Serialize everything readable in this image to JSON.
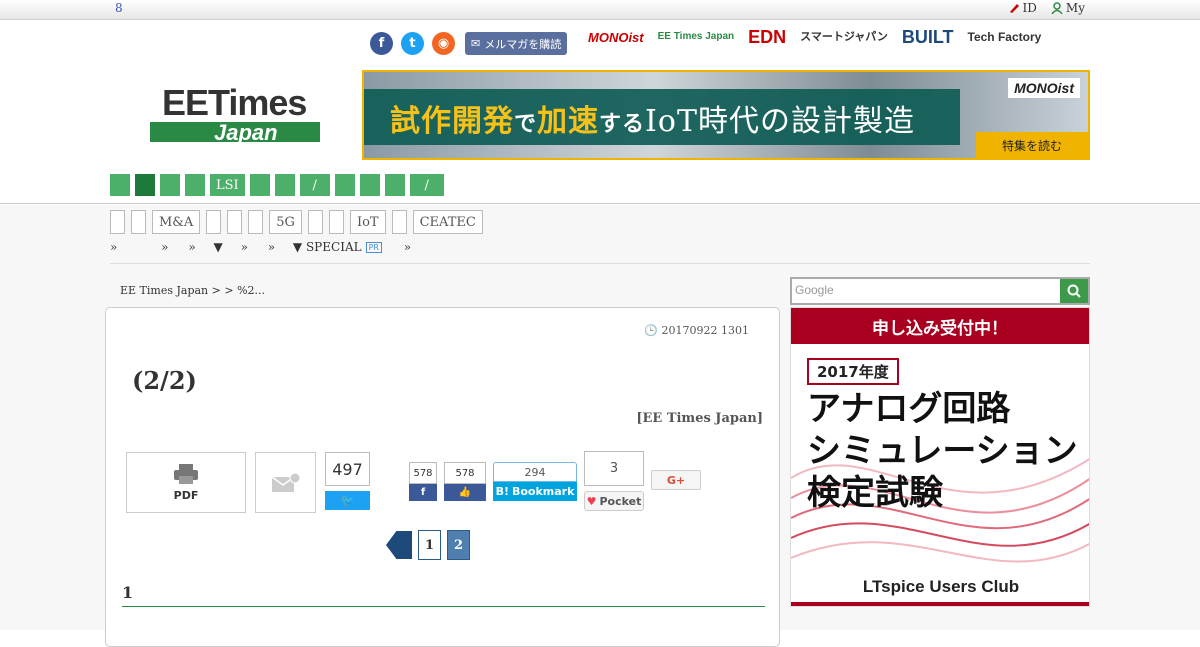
{
  "topbar": {
    "number": "8",
    "id_label": "ID",
    "my_label": "My"
  },
  "header": {
    "tagline": "",
    "mail_button": "メルマガを購読",
    "sites": [
      "MONOist",
      "EE Times Japan",
      "EDN",
      "スマートジャパン",
      "BUILT",
      "Tech Factory"
    ],
    "logo_top": "EETimes",
    "logo_bottom": "Japan",
    "banner": {
      "text_a": "試作開発",
      "text_b": "で",
      "text_c": "加速",
      "text_d": "する",
      "text_e": "IoT時代の設計製造",
      "brand": "MONOist",
      "cta": "特集を読む"
    },
    "colors": {
      "brand_green": "#2a8a45",
      "accent_red": "#c00",
      "banner_gold": "#f0b400"
    }
  },
  "nav": [
    "",
    "",
    "",
    "",
    "LSI",
    "",
    "",
    "/",
    "",
    "",
    "",
    "/"
  ],
  "tags": [
    "",
    "",
    "M&A",
    "",
    "",
    "",
    "5G",
    "",
    "",
    "IoT",
    "",
    "CEATEC"
  ],
  "subnav": {
    "a": "»",
    "b": "»",
    "c": "»",
    "d": "▼",
    "e": "»",
    "f": "»",
    "g": "▼ SPECIAL",
    "pr": "PR",
    "h": "»"
  },
  "breadcrumb": "EE Times Japan >  >  %2...",
  "article": {
    "date": "20170922 1301",
    "title": "(2/2)",
    "byline": "[EE Times Japan]",
    "pdf_label": "PDF",
    "tweet_count": "497",
    "fb_share_count": "578",
    "fb_like_count": "578",
    "hatena_count": "294",
    "hatena_label": "Bookmark",
    "pocket_count": "3",
    "pocket_label": "Pocket",
    "gplus_label": "G+",
    "pages": [
      "1",
      "2"
    ],
    "current_page": "2",
    "section_heading": "1"
  },
  "sidebar": {
    "search_placeholder": "Google",
    "ad": {
      "header": "申し込み受付中！",
      "year": "2017年度",
      "title_lines": [
        "アナログ回路",
        "シミュレーション",
        "検定試験"
      ],
      "footer": "LTspice Users Club"
    }
  }
}
